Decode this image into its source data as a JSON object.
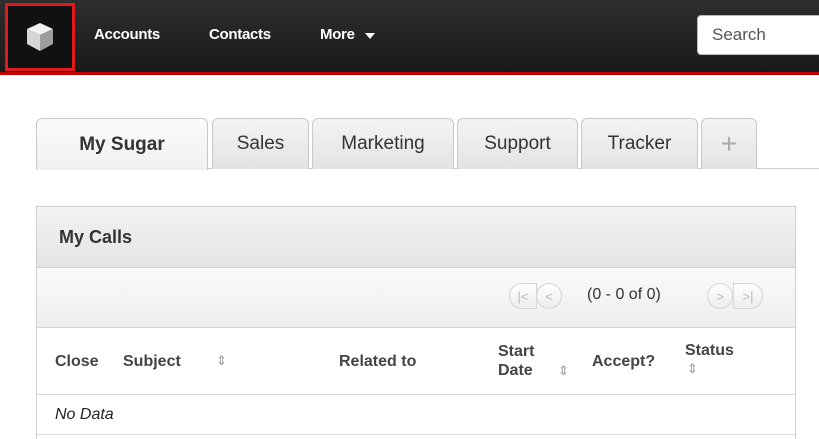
{
  "nav": {
    "logo_icon": "sugar-cube-icon",
    "items": [
      {
        "label": "Accounts"
      },
      {
        "label": "Contacts"
      },
      {
        "label": "More"
      }
    ],
    "search_placeholder": "Search",
    "accent_color": "#c00000"
  },
  "tabs": [
    {
      "label": "My Sugar",
      "active": true
    },
    {
      "label": "Sales"
    },
    {
      "label": "Marketing"
    },
    {
      "label": "Support"
    },
    {
      "label": "Tracker"
    },
    {
      "label": "+"
    }
  ],
  "dashlet": {
    "title": "My Calls",
    "pager": {
      "text": "(0 - 0 of 0)",
      "first_icon": "first-page-icon",
      "prev_icon": "previous-page-icon",
      "next_icon": "next-page-icon",
      "last_icon": "last-page-icon"
    },
    "columns": {
      "close": "Close",
      "subject": "Subject",
      "related": "Related to",
      "start_line1": "Start",
      "start_line2": "Date",
      "accept": "Accept?",
      "status": "Status"
    },
    "empty_text": "No Data"
  }
}
